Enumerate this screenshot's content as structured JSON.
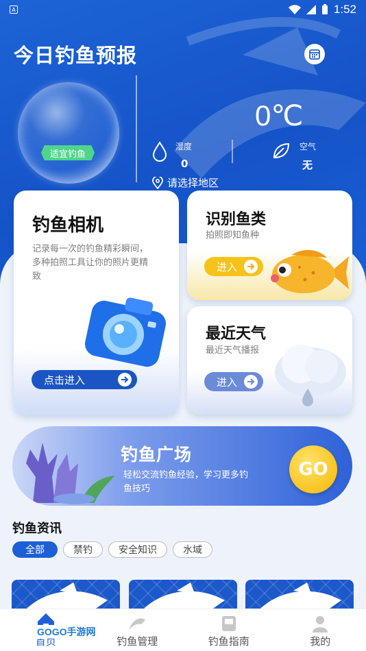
{
  "status_bar": {
    "time": "1:52"
  },
  "header": {
    "title": "今日钓鱼预报"
  },
  "forecast": {
    "bubble_tag": "适宜钓鱼",
    "temperature": "0℃",
    "humidity_label": "湿度",
    "humidity_value": "0",
    "air_label": "空气",
    "air_value": "无",
    "region": "请选择地区"
  },
  "cards": {
    "camera": {
      "title": "钓鱼相机",
      "desc": "记录每一次的钓鱼精彩瞬间，多种拍照工具让你的照片更精致",
      "button": "点击进入"
    },
    "fish": {
      "title": "识别鱼类",
      "desc": "拍照即知鱼种",
      "button": "进入"
    },
    "weather": {
      "title": "最近天气",
      "desc": "最近天气播报",
      "button": "进入"
    }
  },
  "plaza": {
    "title": "钓鱼广场",
    "desc": "轻松交流钓鱼经验，学习更多钓鱼技巧",
    "go": "GO"
  },
  "news": {
    "title": "钓鱼资讯",
    "chips": [
      "全部",
      "禁钓",
      "安全知识",
      "水域"
    ]
  },
  "tabbar": {
    "tabs": [
      "首页",
      "钓鱼管理",
      "钓鱼指南",
      "我的"
    ]
  },
  "watermark": "GOGO手游网",
  "colors": {
    "primary": "#1d5fd6",
    "accent_yellow": "#f7c21a",
    "tag_green": "#4fd58b"
  }
}
